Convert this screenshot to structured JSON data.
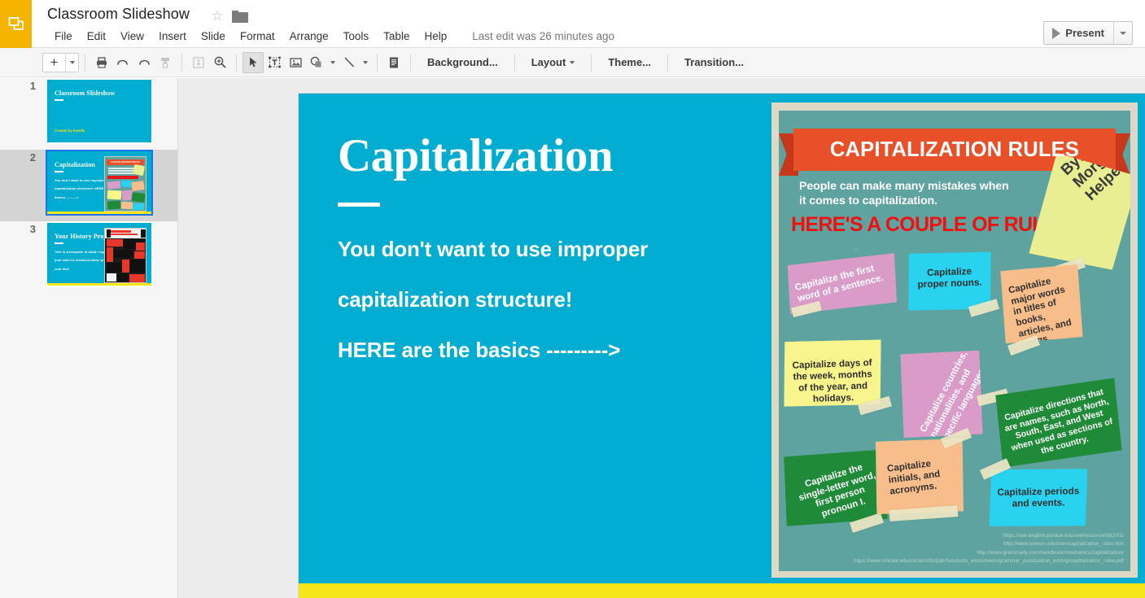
{
  "header": {
    "app_icon": "slides-logo-icon",
    "doc_title": "Classroom Slideshow",
    "star_glyph": "☆",
    "menus": [
      "File",
      "Edit",
      "View",
      "Insert",
      "Slide",
      "Format",
      "Arrange",
      "Tools",
      "Table",
      "Help"
    ],
    "last_edit": "Last edit was 26 minutes ago",
    "present_label": "Present"
  },
  "toolbar": {
    "new_slide_plus": "+",
    "buttons": [
      "print-icon",
      "undo-icon",
      "redo-icon",
      "paint-format-icon",
      "fit-to-window-icon",
      "zoom-icon",
      "select-icon",
      "text-box-icon",
      "image-icon",
      "shape-icon",
      "line-icon",
      "speaker-notes-icon"
    ],
    "background_label": "Background...",
    "layout_label": "Layout",
    "theme_label": "Theme...",
    "transition_label": "Transition..."
  },
  "filmstrip": {
    "slides": [
      {
        "number": "1",
        "title": "Classroom Slideshow",
        "subtitle": "Created by Easelly",
        "selected": false,
        "has_poster": false
      },
      {
        "number": "2",
        "title": "Capitalization",
        "body": "You don't want to use improper capitalization structure! HERE are the basics --------->",
        "selected": true,
        "has_poster": true,
        "poster_banner": "CAPITALIZATION RULES"
      },
      {
        "number": "3",
        "title": "Your History Project",
        "body": "This is a template of what I expect your able-to-research-alone project to look like!",
        "selected": false,
        "has_poster": true
      }
    ]
  },
  "slide": {
    "title": "Capitalization",
    "body_lines": [
      "You don't want to use improper",
      "capitalization structure!",
      "HERE are the basics --------->"
    ],
    "background_color": "#00ACD0",
    "accent_bar_color": "#F5E51A"
  },
  "poster": {
    "banner_title": "CAPITALIZATION RULES",
    "subtitle": "People can make many mistakes when it comes to capitalization.",
    "headline": "HERE'S A COUPLE OF RULES!",
    "byline": "By:\nMorgan\nHelpert",
    "byline_lines": [
      "By:",
      "Morgan",
      "Helpert"
    ],
    "notes": [
      {
        "text": "Capitalize the first word of a sentence.",
        "color": "#D99BC8",
        "text_color": "light"
      },
      {
        "text": "Capitalize proper nouns.",
        "color": "#29D2EE",
        "text_color": "dark"
      },
      {
        "text": "Capitalize major words in titles of books, articles, and songs.",
        "color": "#F7BE8C",
        "text_color": "dark"
      },
      {
        "text": "Capitalize days of the week, months of the year, and holidays.",
        "color": "#F7F58C",
        "text_color": "dark"
      },
      {
        "text": "Capitalize countries, nationalities, and specific languages.",
        "color": "#D99BC8",
        "text_color": "light"
      },
      {
        "text": "Capitalize directions that are names, such as North, South, East, and West when used as sections of the country.",
        "color": "#1F8A38",
        "text_color": "light"
      },
      {
        "text": "Capitalize the single-letter word, first person pronoun  I.",
        "color": "#1F8A38",
        "text_color": "light"
      },
      {
        "text": "Capitalize initials, and acronyms.",
        "color": "#F7BE8C",
        "text_color": "dark"
      },
      {
        "text": "Capitalize periods and events.",
        "color": "#29D2EE",
        "text_color": "dark"
      }
    ],
    "sources": [
      "https://owl.english.purdue.edu/owl/resource/592/01/",
      "http://www.towson.edu/ows/capitalization_rules.htm",
      "http://www.grammarly.com/handbook/mechanics/capitalization/",
      "https://www.sinclair.edu/centers/tlc/pub/handouts_worksheets/grammar_punctuation_writing/capitalization_rules.pdf"
    ]
  }
}
